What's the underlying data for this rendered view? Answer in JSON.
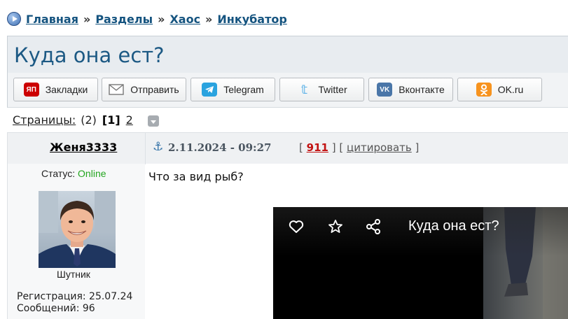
{
  "breadcrumb": {
    "items": [
      "Главная",
      "Разделы",
      "Хаос",
      "Инкубатор"
    ],
    "separator": "»"
  },
  "topic": {
    "title": "Куда она ест?"
  },
  "share": {
    "buttons": [
      {
        "label": "Закладки",
        "icon": "yandex-bookmarks-icon",
        "icon_text": "ЯП",
        "color": "#cc0000"
      },
      {
        "label": "Отправить",
        "icon": "mail-icon",
        "color": "#666666"
      },
      {
        "label": "Telegram",
        "icon": "telegram-icon",
        "color": "#2aa3df"
      },
      {
        "label": "Twitter",
        "icon": "twitter-icon",
        "color": "#5db2e8"
      },
      {
        "label": "Вконтакте",
        "icon": "vk-icon",
        "icon_text": "VK",
        "color": "#4a76a8"
      },
      {
        "label": "OK.ru",
        "icon": "odnoklassniki-icon",
        "color": "#f7931e"
      }
    ]
  },
  "pagination": {
    "label": "Страницы:",
    "count": "(2)",
    "current": "[1]",
    "next": "2"
  },
  "post": {
    "author": "Женя3333",
    "date": "2.11.2024 - 09:27",
    "open_bracket": "[",
    "number": "911",
    "mid_bracket": "] [",
    "quote_label": "цитировать",
    "close_bracket": "]",
    "text": "Что за вид рыб?"
  },
  "user": {
    "status_label": "Статус:",
    "status_value": "Online",
    "rank": "Шутник",
    "registration": "Регистрация: 25.07.24",
    "posts": "Сообщений: 96"
  },
  "video": {
    "title": "Куда она ест?",
    "icons": [
      "heart-icon",
      "star-icon",
      "share-icon"
    ]
  },
  "colors": {
    "link": "#14537f",
    "title": "#1c5984",
    "online": "#23a51f",
    "post_number": "#c21212"
  }
}
